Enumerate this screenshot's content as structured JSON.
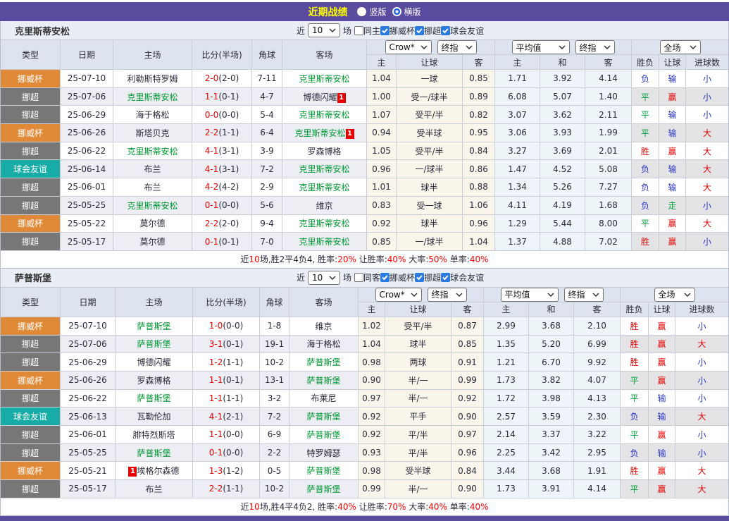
{
  "topbar": {
    "title": "近期战绩",
    "radio_vertical": "竖版",
    "radio_horizontal": "横版",
    "selected": "横版"
  },
  "filter_labels": {
    "near": "近",
    "count": "10",
    "games": "场",
    "leagues": [
      "挪威杯",
      "挪超",
      "球会友谊"
    ]
  },
  "selects": {
    "bookmaker": "Crow*",
    "final": "终指",
    "average": "平均值",
    "final2": "终指",
    "fulltime": "全场"
  },
  "columns": {
    "type": "类型",
    "date": "日期",
    "home": "主场",
    "score": "比分(半场)",
    "corner": "角球",
    "away": "客场",
    "asia_home": "主",
    "handicap": "让球",
    "asia_away": "客",
    "eu_home": "主",
    "eu_draw": "和",
    "eu_away": "客",
    "wdl": "胜负",
    "handicap2": "让球",
    "goals": "进球数"
  },
  "summary_labels": {
    "near": "近",
    "games": "场,",
    "sep": ", ",
    "win": "胜率:",
    "let_win": "让胜率:",
    "big": "大率:",
    "single": "单率:"
  },
  "colors": {
    "purple": "#5b4b9e",
    "title_yellow": "#ffff00",
    "league": {
      "挪威杯": "#e08a38",
      "挪超": "#777777",
      "球会友谊": "#17aca6"
    },
    "result": {
      "胜": "#e60000",
      "平": "#00a03c",
      "负": "#2a35c8",
      "赢": "#e60000",
      "输": "#2a35c8",
      "走": "#00a03c",
      "大": "#e60000",
      "小": "#2a35c8"
    },
    "team_green": "#009933",
    "score_red": "#e60000"
  },
  "blocks": [
    {
      "team": "克里斯蒂安松",
      "same_label": "同主",
      "same_checked": false,
      "summary": {
        "games": "10",
        "record": "胜2平4负4",
        "win_rate": "20%",
        "let_win_rate": "40%",
        "big_rate": "50%",
        "single_rate": "40%"
      },
      "rows": [
        {
          "lg": "挪威杯",
          "date": "25-07-10",
          "home": "利勒斯特罗姆",
          "hG": false,
          "hB": null,
          "score": "2-0",
          "half": "(2-0)",
          "cn": "7-11",
          "away": "克里斯蒂安松",
          "aG": true,
          "aB": null,
          "asia": [
            "1.04",
            "一球",
            "0.85"
          ],
          "eu": [
            "1.71",
            "3.92",
            "4.14"
          ],
          "res": [
            "负",
            "输",
            "小"
          ]
        },
        {
          "lg": "挪超",
          "date": "25-07-06",
          "home": "克里斯蒂安松",
          "hG": true,
          "hB": null,
          "score": "1-1",
          "half": "(0-1)",
          "cn": "4-7",
          "away": "博德闪耀",
          "aG": false,
          "aB": {
            "text": "1",
            "pos": "after"
          },
          "asia": [
            "1.00",
            "受一/球半",
            "0.89"
          ],
          "eu": [
            "6.08",
            "5.07",
            "1.40"
          ],
          "res": [
            "平",
            "赢",
            "小"
          ]
        },
        {
          "lg": "挪超",
          "date": "25-06-29",
          "home": "海于格松",
          "hG": false,
          "hB": null,
          "score": "0-0",
          "half": "(0-0)",
          "cn": "5-4",
          "away": "克里斯蒂安松",
          "aG": true,
          "aB": null,
          "asia": [
            "1.07",
            "受平/半",
            "0.82"
          ],
          "eu": [
            "3.07",
            "3.62",
            "2.11"
          ],
          "res": [
            "平",
            "输",
            "小"
          ]
        },
        {
          "lg": "挪威杯",
          "date": "25-06-26",
          "home": "斯塔贝克",
          "hG": false,
          "hB": null,
          "score": "2-2",
          "half": "(1-1)",
          "cn": "6-4",
          "away": "克里斯蒂安松",
          "aG": true,
          "aB": {
            "text": "1",
            "pos": "after"
          },
          "asia": [
            "0.94",
            "受半球",
            "0.95"
          ],
          "eu": [
            "3.06",
            "3.93",
            "1.99"
          ],
          "res": [
            "平",
            "输",
            "大"
          ]
        },
        {
          "lg": "挪超",
          "date": "25-06-22",
          "home": "克里斯蒂安松",
          "hG": true,
          "hB": null,
          "score": "4-1",
          "half": "(3-1)",
          "cn": "3-9",
          "away": "罗森博格",
          "aG": false,
          "aB": null,
          "asia": [
            "1.05",
            "受平/半",
            "0.84"
          ],
          "eu": [
            "3.27",
            "3.69",
            "2.01"
          ],
          "res": [
            "胜",
            "赢",
            "大"
          ]
        },
        {
          "lg": "球会友谊",
          "date": "25-06-14",
          "home": "布兰",
          "hG": false,
          "hB": null,
          "score": "4-1",
          "half": "(3-1)",
          "cn": "7-2",
          "away": "克里斯蒂安松",
          "aG": true,
          "aB": null,
          "asia": [
            "0.96",
            "一/球半",
            "0.86"
          ],
          "eu": [
            "1.47",
            "4.52",
            "5.08"
          ],
          "res": [
            "负",
            "输",
            "大"
          ]
        },
        {
          "lg": "挪超",
          "date": "25-06-01",
          "home": "布兰",
          "hG": false,
          "hB": null,
          "score": "4-2",
          "half": "(4-2)",
          "cn": "2-9",
          "away": "克里斯蒂安松",
          "aG": true,
          "aB": null,
          "asia": [
            "1.01",
            "球半",
            "0.88"
          ],
          "eu": [
            "1.34",
            "5.26",
            "7.27"
          ],
          "res": [
            "负",
            "输",
            "大"
          ]
        },
        {
          "lg": "挪超",
          "date": "25-05-25",
          "home": "克里斯蒂安松",
          "hG": true,
          "hB": null,
          "score": "0-1",
          "half": "(0-0)",
          "cn": "5-6",
          "away": "维京",
          "aG": false,
          "aB": null,
          "asia": [
            "0.83",
            "受一球",
            "1.06"
          ],
          "eu": [
            "4.11",
            "4.19",
            "1.68"
          ],
          "res": [
            "负",
            "走",
            "小"
          ]
        },
        {
          "lg": "挪威杯",
          "date": "25-05-22",
          "home": "莫尔德",
          "hG": false,
          "hB": null,
          "score": "2-2",
          "half": "(2-0)",
          "cn": "9-4",
          "away": "克里斯蒂安松",
          "aG": true,
          "aB": null,
          "asia": [
            "0.92",
            "球半",
            "0.96"
          ],
          "eu": [
            "1.29",
            "5.44",
            "8.00"
          ],
          "res": [
            "平",
            "赢",
            "大"
          ]
        },
        {
          "lg": "挪超",
          "date": "25-05-17",
          "home": "莫尔德",
          "hG": false,
          "hB": null,
          "score": "0-1",
          "half": "(0-1)",
          "cn": "7-0",
          "away": "克里斯蒂安松",
          "aG": true,
          "aB": null,
          "asia": [
            "0.85",
            "一/球半",
            "1.04"
          ],
          "eu": [
            "1.37",
            "4.88",
            "7.02"
          ],
          "res": [
            "胜",
            "赢",
            "小"
          ]
        }
      ]
    },
    {
      "team": "萨普斯堡",
      "same_label": "同客",
      "same_checked": false,
      "summary": {
        "games": "10",
        "record": "胜4平4负2",
        "win_rate": "40%",
        "let_win_rate": "70%",
        "big_rate": "40%",
        "single_rate": "40%"
      },
      "rows": [
        {
          "lg": "挪威杯",
          "date": "25-07-10",
          "home": "萨普斯堡",
          "hG": true,
          "hB": null,
          "score": "1-0",
          "half": "(0-0)",
          "cn": "1-8",
          "away": "维京",
          "aG": false,
          "aB": null,
          "asia": [
            "1.02",
            "受平/半",
            "0.87"
          ],
          "eu": [
            "2.99",
            "3.68",
            "2.10"
          ],
          "res": [
            "胜",
            "赢",
            "小"
          ]
        },
        {
          "lg": "挪超",
          "date": "25-07-06",
          "home": "萨普斯堡",
          "hG": true,
          "hB": null,
          "score": "3-1",
          "half": "(0-1)",
          "cn": "19-1",
          "away": "海于格松",
          "aG": false,
          "aB": null,
          "asia": [
            "1.04",
            "球半",
            "0.85"
          ],
          "eu": [
            "1.35",
            "5.20",
            "6.99"
          ],
          "res": [
            "胜",
            "赢",
            "大"
          ]
        },
        {
          "lg": "挪超",
          "date": "25-06-29",
          "home": "博德闪耀",
          "hG": false,
          "hB": null,
          "score": "1-2",
          "half": "(1-1)",
          "cn": "10-2",
          "away": "萨普斯堡",
          "aG": true,
          "aB": null,
          "asia": [
            "0.98",
            "两球",
            "0.91"
          ],
          "eu": [
            "1.21",
            "6.70",
            "9.92"
          ],
          "res": [
            "胜",
            "赢",
            "小"
          ]
        },
        {
          "lg": "挪威杯",
          "date": "25-06-26",
          "home": "罗森博格",
          "hG": false,
          "hB": null,
          "score": "1-1",
          "half": "(0-1)",
          "cn": "13-1",
          "away": "萨普斯堡",
          "aG": true,
          "aB": null,
          "asia": [
            "0.90",
            "半/一",
            "0.99"
          ],
          "eu": [
            "1.73",
            "3.82",
            "4.07"
          ],
          "res": [
            "平",
            "赢",
            "小"
          ]
        },
        {
          "lg": "挪超",
          "date": "25-06-22",
          "home": "萨普斯堡",
          "hG": true,
          "hB": null,
          "score": "1-1",
          "half": "(1-1)",
          "cn": "3-2",
          "away": "布莱尼",
          "aG": false,
          "aB": null,
          "asia": [
            "0.97",
            "半/一",
            "0.92"
          ],
          "eu": [
            "1.72",
            "3.98",
            "4.13"
          ],
          "res": [
            "平",
            "输",
            "小"
          ]
        },
        {
          "lg": "球会友谊",
          "date": "25-06-13",
          "home": "瓦勒伦加",
          "hG": false,
          "hB": null,
          "score": "4-1",
          "half": "(2-1)",
          "cn": "7-2",
          "away": "萨普斯堡",
          "aG": true,
          "aB": null,
          "asia": [
            "0.92",
            "平手",
            "0.90"
          ],
          "eu": [
            "2.57",
            "3.59",
            "2.30"
          ],
          "res": [
            "负",
            "输",
            "大"
          ]
        },
        {
          "lg": "挪超",
          "date": "25-06-01",
          "home": "腓特烈斯塔",
          "hG": false,
          "hB": null,
          "score": "1-1",
          "half": "(0-0)",
          "cn": "6-9",
          "away": "萨普斯堡",
          "aG": true,
          "aB": null,
          "asia": [
            "0.92",
            "平/半",
            "0.97"
          ],
          "eu": [
            "2.14",
            "3.37",
            "3.22"
          ],
          "res": [
            "平",
            "赢",
            "小"
          ]
        },
        {
          "lg": "挪超",
          "date": "25-05-25",
          "home": "萨普斯堡",
          "hG": true,
          "hB": null,
          "score": "0-1",
          "half": "(0-0)",
          "cn": "2-2",
          "away": "特罗姆瑟",
          "aG": false,
          "aB": null,
          "asia": [
            "0.93",
            "平/半",
            "0.96"
          ],
          "eu": [
            "2.25",
            "3.42",
            "2.95"
          ],
          "res": [
            "负",
            "输",
            "小"
          ]
        },
        {
          "lg": "挪威杯",
          "date": "25-05-21",
          "home": "埃格尔森德",
          "hG": false,
          "hB": {
            "text": "1",
            "pos": "before"
          },
          "score": "1-3",
          "half": "(1-2)",
          "cn": "0-5",
          "away": "萨普斯堡",
          "aG": true,
          "aB": null,
          "asia": [
            "0.98",
            "受半球",
            "0.84"
          ],
          "eu": [
            "3.44",
            "3.68",
            "1.91"
          ],
          "res": [
            "胜",
            "赢",
            "大"
          ]
        },
        {
          "lg": "挪超",
          "date": "25-05-17",
          "home": "布兰",
          "hG": false,
          "hB": null,
          "score": "2-2",
          "half": "(1-1)",
          "cn": "10-2",
          "away": "萨普斯堡",
          "aG": true,
          "aB": null,
          "asia": [
            "0.99",
            "半/一",
            "0.90"
          ],
          "eu": [
            "1.73",
            "3.91",
            "4.14"
          ],
          "res": [
            "平",
            "赢",
            "大"
          ]
        }
      ]
    }
  ]
}
